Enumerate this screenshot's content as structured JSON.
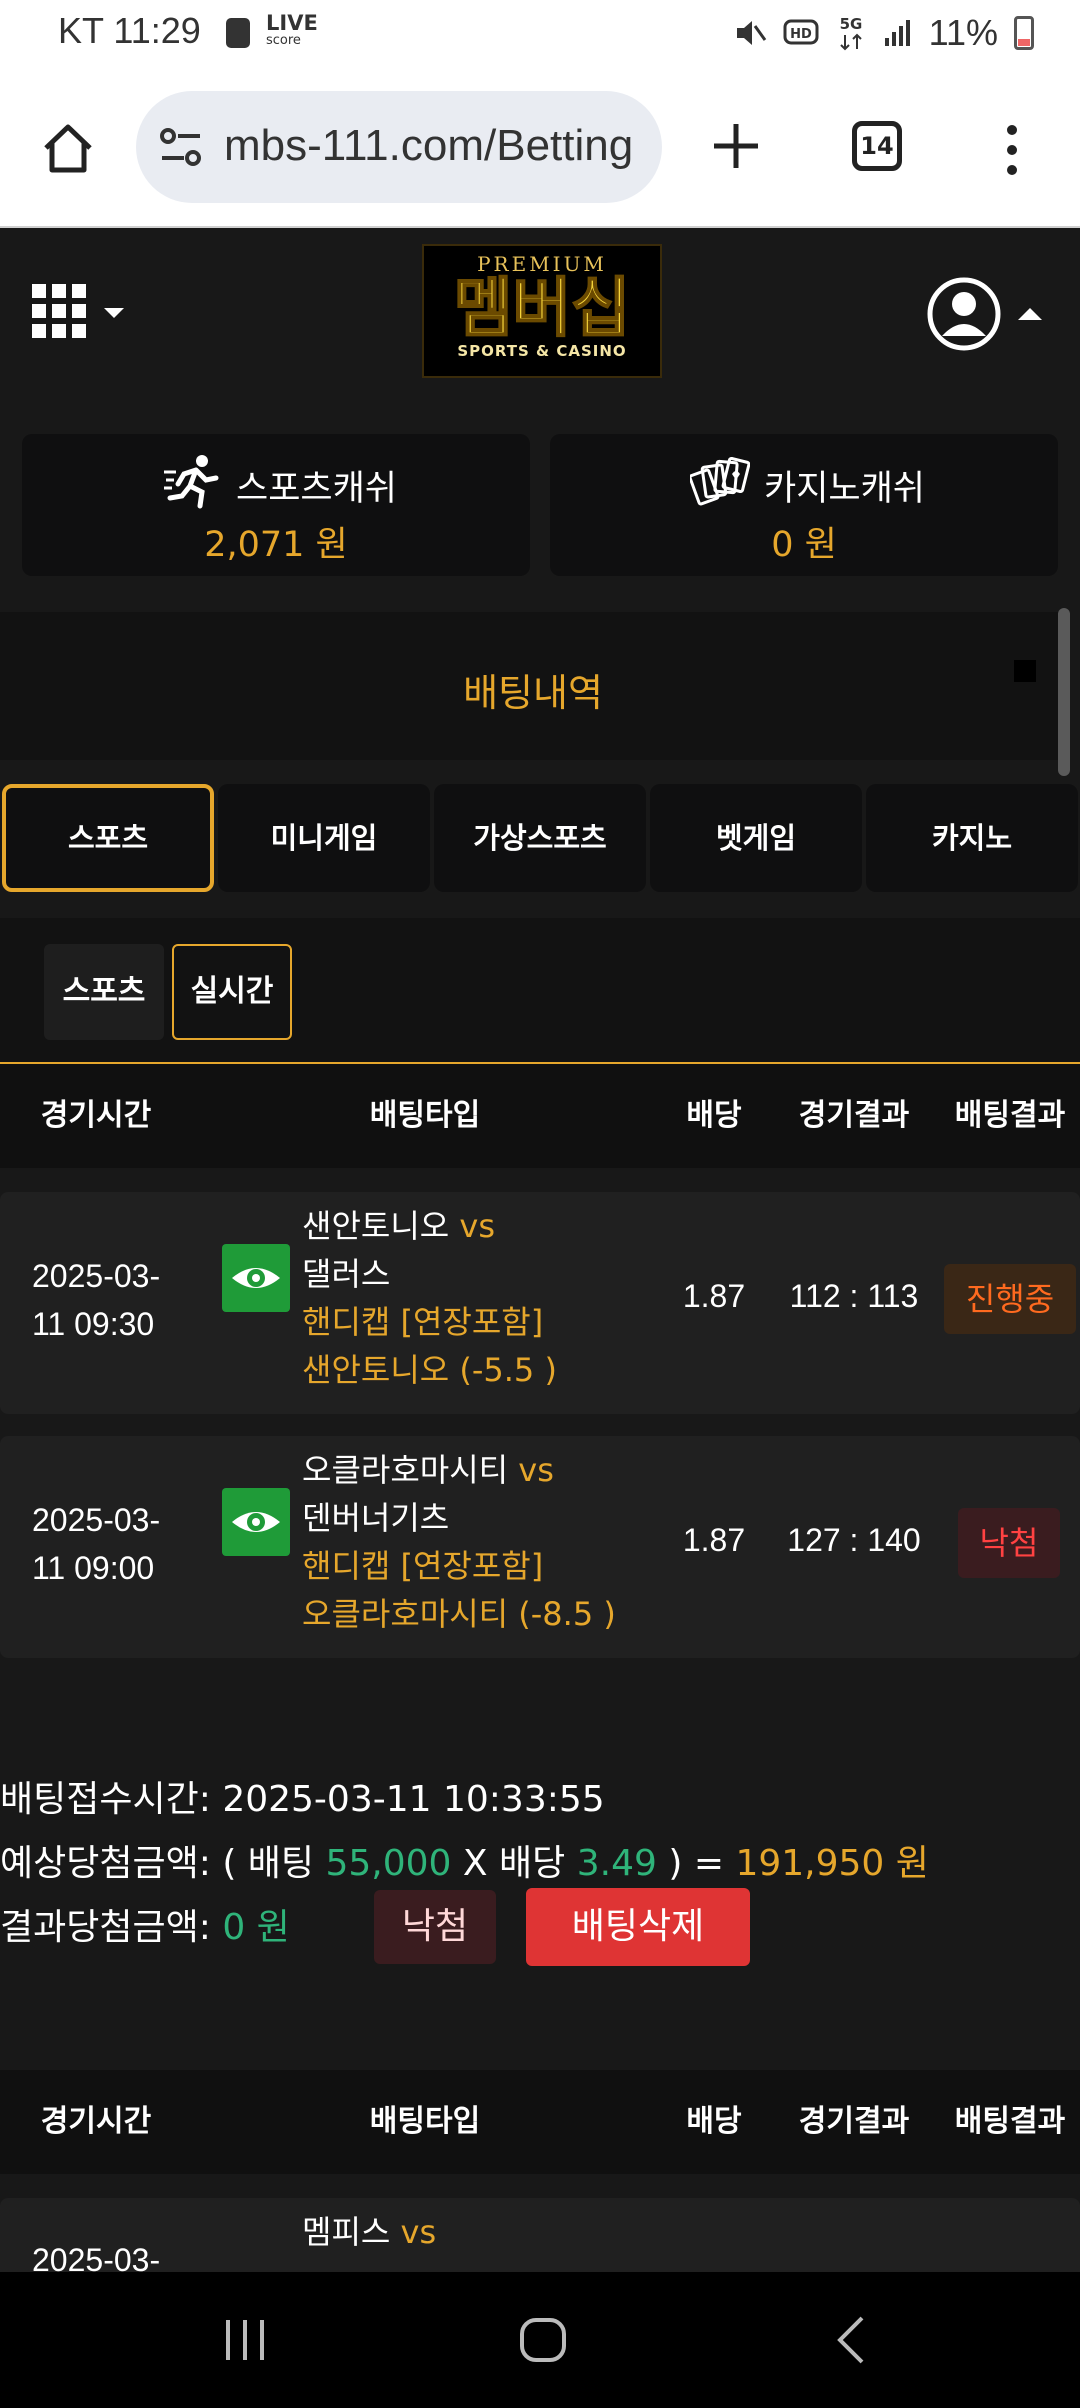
{
  "statusbar": {
    "time": "KT 11:29",
    "live_label": "LIVE",
    "live_sub": "score",
    "battery": "11%",
    "network": "5G",
    "hd": "HD"
  },
  "browser": {
    "url": "mbs-111.com/Betting",
    "tab_count": "14"
  },
  "header": {
    "logo_premium": "PREMIUM",
    "logo_name": "멤버십",
    "logo_sub": "SPORTS & CASINO"
  },
  "cash": {
    "sports": {
      "label": "스포츠캐쉬",
      "amount": "2,071 원"
    },
    "casino": {
      "label": "카지노캐쉬",
      "amount": "0 원"
    }
  },
  "section_title": "배팅내역",
  "tabs": [
    "스포츠",
    "미니게임",
    "가상스포츠",
    "벳게임",
    "카지노"
  ],
  "subtabs": [
    "스포츠",
    "실시간"
  ],
  "table_headers": [
    "경기시간",
    "배팅타입",
    "배당",
    "경기결과",
    "배팅결과"
  ],
  "bets": [
    {
      "date": "2025-03-",
      "time": "11 09:30",
      "home": "샌안토니오",
      "vs": "vs",
      "away": "댈러스",
      "market": "핸디캡 [연장포함]",
      "pick": "샌안토니오 (-5.5 )",
      "odds": "1.87",
      "score": "112 : 113",
      "result": "진행중"
    },
    {
      "date": "2025-03-",
      "time": "11 09:00",
      "home": "오클라호마시티",
      "vs": "vs",
      "away": "덴버너기츠",
      "market": "핸디캡 [연장포함]",
      "pick": "오클라호마시티 (-8.5 )",
      "odds": "1.87",
      "score": "127 : 140",
      "result": "낙첨"
    }
  ],
  "summary": {
    "accepted_label": "배팅접수시간:",
    "accepted_value": "2025-03-11 10:33:55",
    "expected_label": "예상당첨금액:",
    "expected_open": "( 배팅",
    "stake": "55,000",
    "x_label": "X 배당",
    "total_odds": "3.49",
    "expected_close": ") =",
    "expected_amount": "191,950 원",
    "result_label": "결과당첨금액:",
    "result_amount": "0 원",
    "lose_button": "낙첨",
    "delete_button": "배팅삭제"
  },
  "bet2": {
    "date": "2025-03-",
    "home": "멤피스",
    "vs": "vs"
  }
}
